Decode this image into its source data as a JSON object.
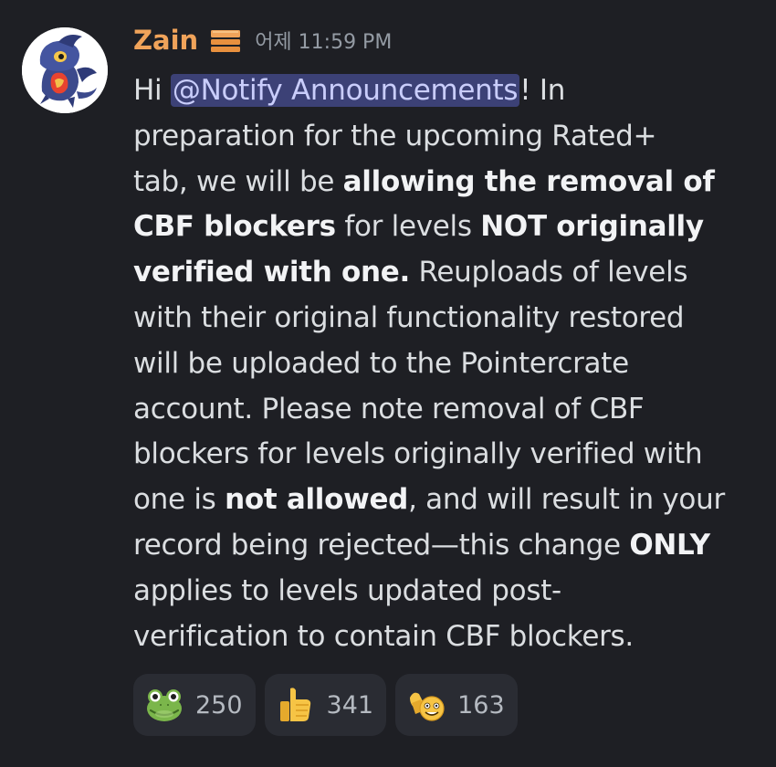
{
  "message": {
    "author": "Zain",
    "timestamp": "어제 11:59 PM",
    "role_icon": "gold-box-icon",
    "avatar": "dragon-avatar",
    "text": {
      "l1_a": "Hi ",
      "mention": "@Notify Announcements",
      "l1_b": "! In",
      "l2": "preparation for the upcoming Rated+",
      "l3_a": "tab, we will be ",
      "l3_b": "allowing the removal of",
      "l4_a": "CBF blockers",
      "l4_b": " for levels ",
      "l4_c": "NOT originally",
      "l5_a": "verified with one.",
      "l5_b": " Reuploads of levels",
      "l6": "with their original functionality restored",
      "l7": "will be uploaded to the Pointercrate",
      "l8": "account. Please note removal of CBF",
      "l9": "blockers for levels originally verified with",
      "l10_a": "one is ",
      "l10_b": "not allowed",
      "l10_c": ", and will result in your",
      "l11_a": "record being rejected—this change ",
      "l11_b": "ONLY",
      "l12": "applies to levels updated post-",
      "l13": "verification to contain CBF blockers."
    },
    "reactions": [
      {
        "emoji": "frog-emoji",
        "count": "250"
      },
      {
        "emoji": "thumbs-up-emoji",
        "count": "341"
      },
      {
        "emoji": "thumbs-up-grinning-emoji",
        "count": "163"
      }
    ]
  },
  "colors": {
    "background": "#1e1f24",
    "username": "#f0a35a",
    "mention_bg": "#3c4176",
    "mention_text": "#c9cdfb",
    "reaction_bg": "#2a2c33"
  }
}
